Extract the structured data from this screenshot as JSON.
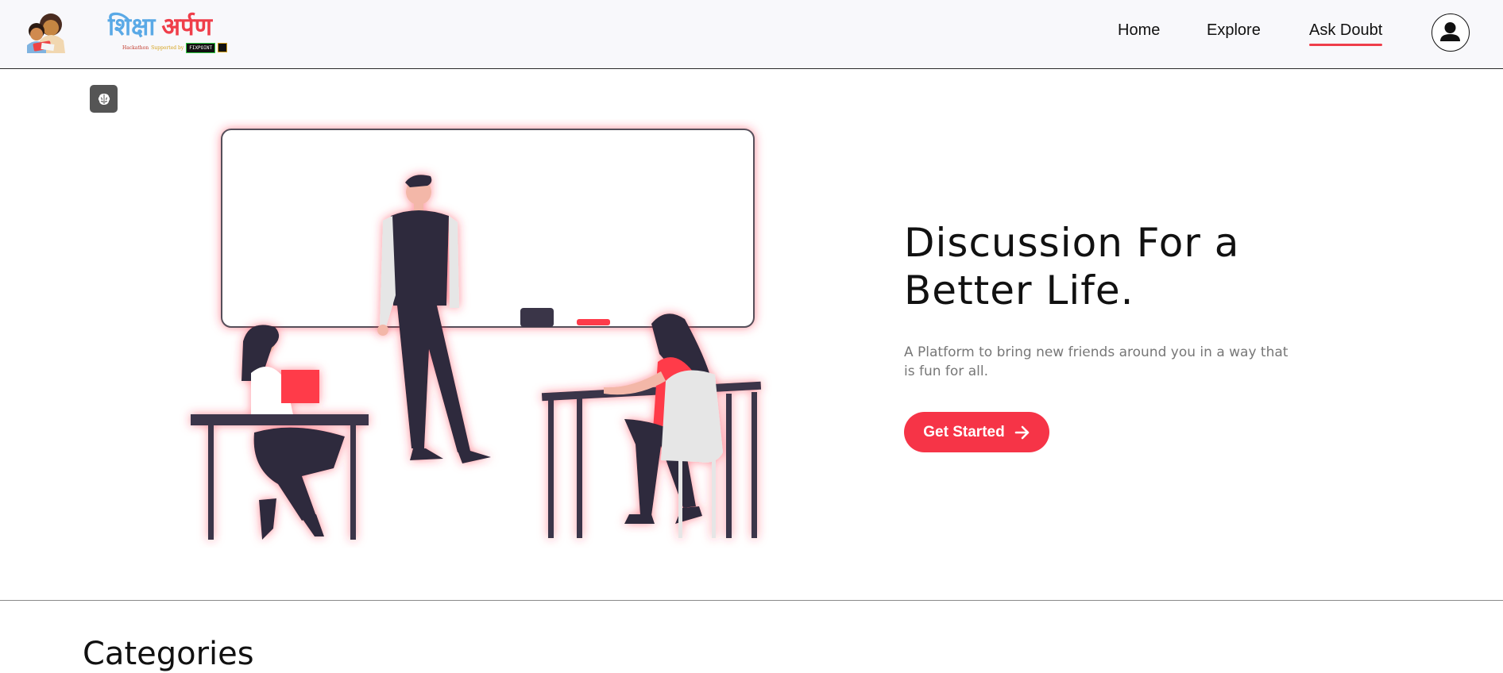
{
  "header": {
    "brand_word1": "शिक्षा",
    "brand_word2": "अर्पण",
    "brand_tagline_hackathon": "Hackathon",
    "brand_tagline_supported": "Supported by",
    "brand_tagline_sponsor": "FIXPOINT",
    "nav": [
      {
        "label": "Home",
        "active": false
      },
      {
        "label": "Explore",
        "active": false
      },
      {
        "label": "Ask Doubt",
        "active": true
      }
    ],
    "active_underline_color": "#ef3e4a",
    "icons": {
      "logo": "children-reading-logo",
      "profile": "user-icon"
    }
  },
  "floating_button": {
    "icon": "brain-icon"
  },
  "hero": {
    "title_line1": "Discussion For a",
    "title_line2": "Better Life.",
    "subtitle": "A Platform to bring new friends around you in a way that is fun for all.",
    "cta_label": "Get Started",
    "cta_icon": "arrow-right-icon",
    "cta_color": "#f63447",
    "illustration": "classroom-discussion-illustration"
  },
  "sections": {
    "categories_title": "Categories"
  }
}
